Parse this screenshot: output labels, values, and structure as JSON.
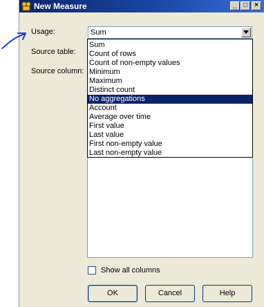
{
  "window": {
    "title": "New Measure",
    "controls": {
      "minimize": "_",
      "maximize": "□",
      "close": "×"
    }
  },
  "form": {
    "usage_label": "Usage:",
    "source_table_label": "Source table:",
    "source_column_label": "Source column:",
    "usage_value": "Sum"
  },
  "dropdown": {
    "options": [
      "Sum",
      "Count of rows",
      "Count of non-empty values",
      "Minimum",
      "Maximum",
      "Distinct count",
      "No aggregations",
      "Account",
      "Average over time",
      "First value",
      "Last value",
      "First non-empty value",
      "Last non-empty value"
    ],
    "highlighted_index": 6
  },
  "show_all_columns": {
    "label": "Show all columns",
    "checked": false
  },
  "buttons": {
    "ok": "OK",
    "cancel": "Cancel",
    "help": "Help"
  },
  "colors": {
    "titlebar": "#0a246a",
    "highlight": "#0a246a",
    "dialog_bg": "#ece9d8",
    "pen_annotation": "#1a3ed8"
  }
}
